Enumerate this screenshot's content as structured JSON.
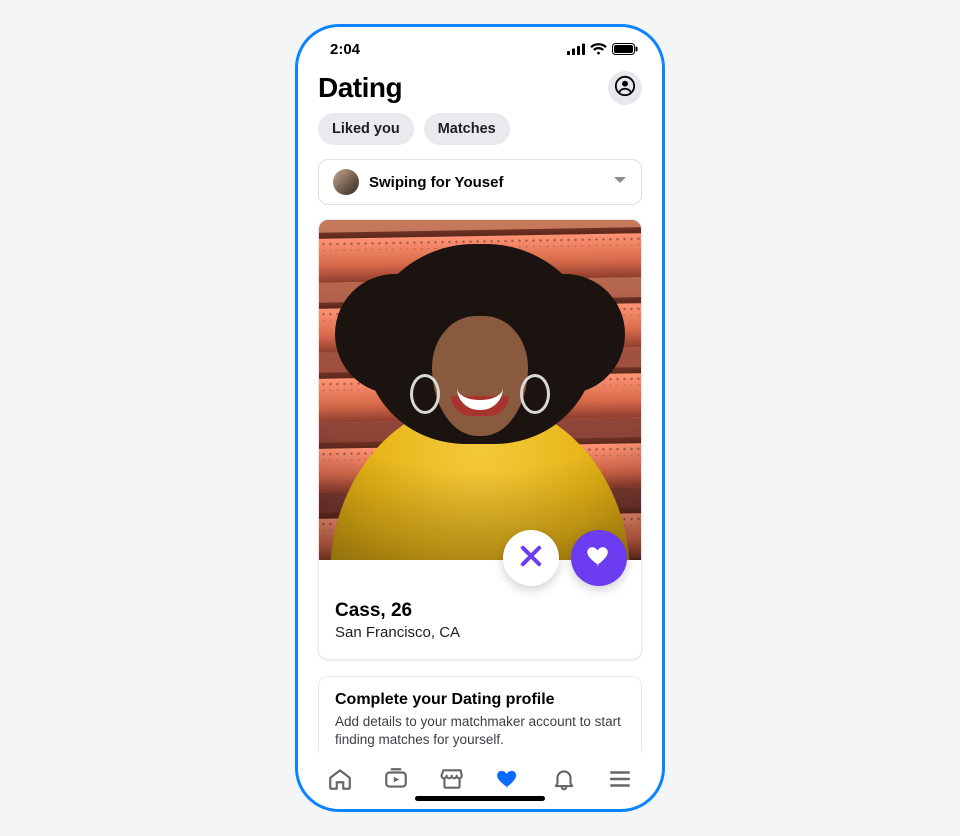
{
  "status": {
    "time": "2:04"
  },
  "header": {
    "title": "Dating"
  },
  "chips": {
    "liked_you": "Liked you",
    "matches": "Matches"
  },
  "swipe_for": {
    "label": "Swiping for Yousef"
  },
  "profile": {
    "name_age": "Cass, 26",
    "location": "San Francisco, CA"
  },
  "promo": {
    "title": "Complete your Dating profile",
    "body": "Add details to your matchmaker account to start finding matches for yourself."
  },
  "colors": {
    "accent_blue": "#0a84ff",
    "like_purple": "#6b3cf0",
    "chip_bg": "#e8eaed"
  }
}
